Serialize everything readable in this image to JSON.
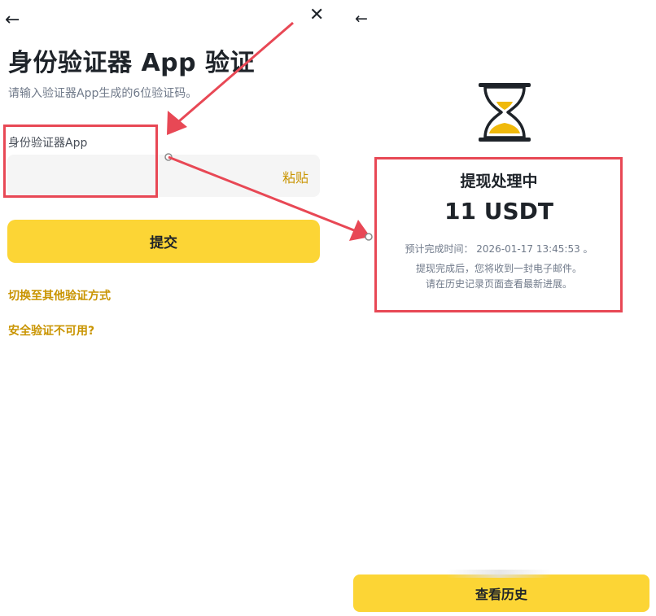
{
  "left": {
    "back_icon": "arrow-left-icon",
    "close_icon": "close-icon",
    "title": "身份验证器 App 验证",
    "subtitle": "请输入验证器App生成的6位验证码。",
    "field_label": "身份验证器App",
    "code_input": {
      "value": "",
      "placeholder": ""
    },
    "paste_label": "粘贴",
    "submit_label": "提交",
    "switch_method_link": "切换至其他验证方式",
    "unavailable_link": "安全验证不可用?"
  },
  "right": {
    "back_icon": "arrow-left-icon",
    "status_icon": "hourglass-icon",
    "status_title": "提现处理中",
    "amount": "11 USDT",
    "eta_label": "预计完成时间：",
    "eta_value": "2026-01-17 13:45:53 。",
    "note_line1": "提现完成后，您将收到一封电子邮件。",
    "note_line2": "请在历史记录页面查看最新进展。",
    "history_button": "查看历史"
  },
  "colors": {
    "accent_yellow": "#fcd535",
    "link_gold": "#c99400",
    "annotation_red": "#e84855",
    "text_primary": "#1e2329",
    "text_secondary": "#707a8a"
  }
}
